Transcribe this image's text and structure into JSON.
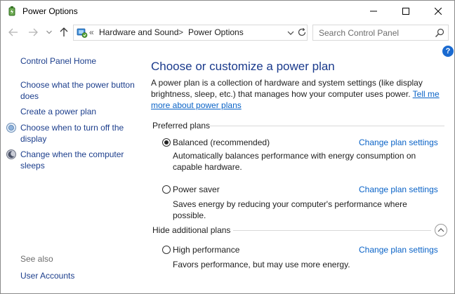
{
  "window": {
    "title": "Power Options"
  },
  "nav": {
    "breadcrumb_lead": "«",
    "crumbs": [
      "Hardware and Sound",
      "Power Options"
    ],
    "separator": ">",
    "search_placeholder": "Search Control Panel"
  },
  "sidebar": {
    "home": "Control Panel Home",
    "links": [
      "Choose what the power button does",
      "Create a power plan",
      "Choose when to turn off the display",
      "Change when the computer sleeps"
    ],
    "see_also_label": "See also",
    "see_also_links": [
      "User Accounts"
    ]
  },
  "main": {
    "help_label": "?",
    "title": "Choose or customize a power plan",
    "description": "A power plan is a collection of hardware and system settings (like display brightness, sleep, etc.) that manages how your computer uses power.",
    "description_link": "Tell me more about power plans",
    "preferred_heading": "Preferred plans",
    "hidden_heading": "Hide additional plans",
    "plans": [
      {
        "name": "Balanced (recommended)",
        "selected": true,
        "change_label": "Change plan settings",
        "description": "Automatically balances performance with energy consumption on capable hardware."
      },
      {
        "name": "Power saver",
        "selected": false,
        "change_label": "Change plan settings",
        "description": "Saves energy by reducing your computer's performance where possible."
      },
      {
        "name": "High performance",
        "selected": false,
        "change_label": "Change plan settings",
        "description": "Favors performance, but may use more energy."
      }
    ]
  },
  "icons": {
    "app": "power-options-icon",
    "back": "back-arrow-icon",
    "forward": "forward-arrow-icon",
    "recent": "chevron-down-icon",
    "up": "up-arrow-icon",
    "location": "control-panel-icon",
    "refresh": "refresh-icon",
    "search": "search-icon",
    "help": "help-icon",
    "collapse": "chevron-up-icon",
    "display": "display-icon",
    "sleep": "sleep-icon"
  },
  "colors": {
    "link": "#1c3e8c",
    "accent_link": "#0a63c7",
    "title": "#1a3a8c",
    "help": "#1a6ad0"
  }
}
